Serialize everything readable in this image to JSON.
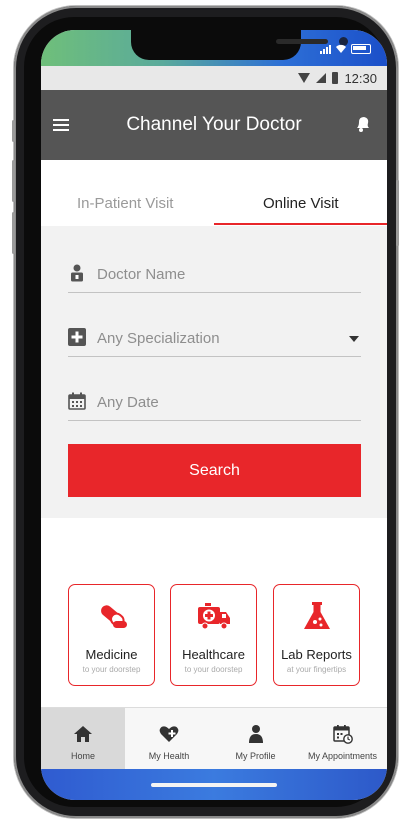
{
  "status_bar": {
    "time": "12:30"
  },
  "app_bar": {
    "title": "Channel Your Doctor"
  },
  "tabs": [
    {
      "label": "In-Patient Visit",
      "active": false
    },
    {
      "label": "Online Visit",
      "active": true
    }
  ],
  "form": {
    "doctor_name_placeholder": "Doctor Name",
    "specialization_placeholder": "Any Specialization",
    "date_placeholder": "Any Date",
    "search_label": "Search"
  },
  "cards": [
    {
      "title": "Medicine",
      "subtitle": "to your doorstep",
      "icon": "pill-icon"
    },
    {
      "title": "Healthcare",
      "subtitle": "to your doorstep",
      "icon": "ambulance-icon"
    },
    {
      "title": "Lab Reports",
      "subtitle": "at your fingertips",
      "icon": "flask-icon"
    }
  ],
  "bottom_nav": [
    {
      "label": "Home",
      "icon": "home-icon",
      "active": true
    },
    {
      "label": "My Health",
      "icon": "heart-plus-icon",
      "active": false
    },
    {
      "label": "My Profile",
      "icon": "person-icon",
      "active": false
    },
    {
      "label": "My Appointments",
      "icon": "calendar-clock-icon",
      "active": false
    }
  ],
  "colors": {
    "accent": "#e8262a",
    "app_bar": "#555555",
    "nav_active_bg": "#d9d9d9"
  }
}
